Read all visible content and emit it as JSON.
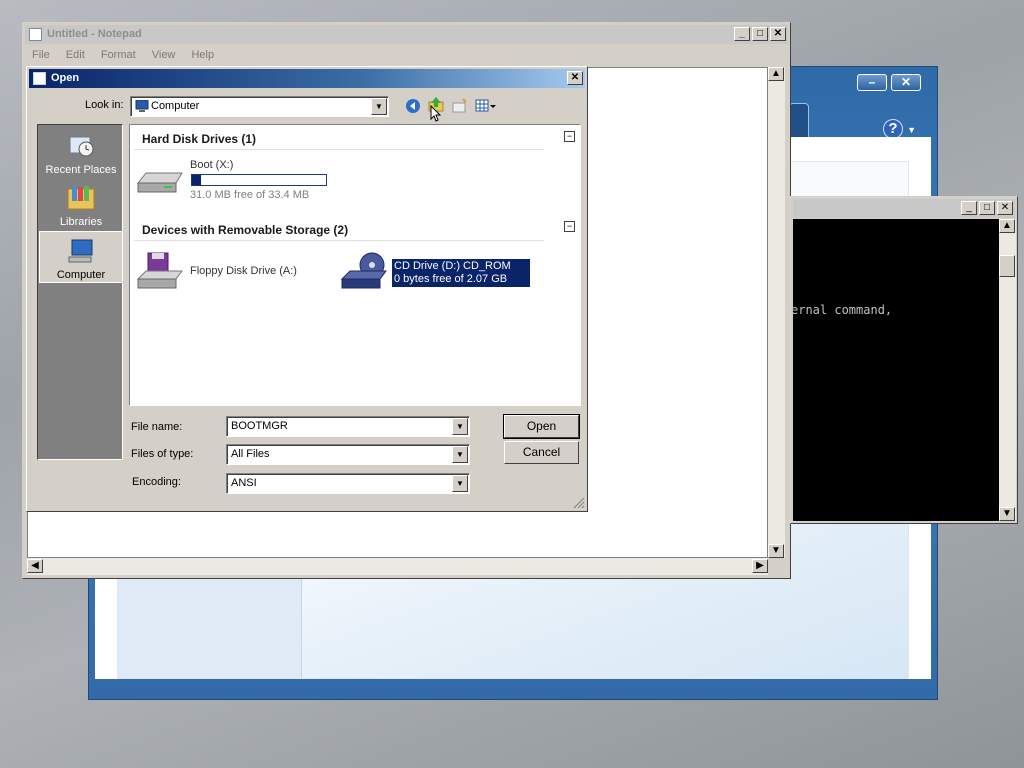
{
  "notepad": {
    "title": "Untitled - Notepad",
    "menu": [
      "File",
      "Edit",
      "Format",
      "View",
      "Help"
    ]
  },
  "setup_window": {
    "help_glyph": "?",
    "minimize": "–",
    "close": "✕"
  },
  "cmd": {
    "visible_text": "ernal command,"
  },
  "open_dialog": {
    "title": "Open",
    "look_in_label": "Look in:",
    "look_in_value": "Computer",
    "places": [
      {
        "label": "Recent Places",
        "icon": "recent-places-icon"
      },
      {
        "label": "Libraries",
        "icon": "libraries-icon"
      },
      {
        "label": "Computer",
        "icon": "computer-icon",
        "selected": true
      }
    ],
    "groups": [
      {
        "heading": "Hard Disk Drives (1)"
      },
      {
        "heading": "Devices with Removable Storage (2)"
      }
    ],
    "drives": {
      "boot": {
        "name": "Boot (X:)",
        "free_text": "31.0 MB free of 33.4 MB",
        "used_fraction": 0.07
      },
      "floppy": {
        "name": "Floppy Disk Drive (A:)"
      },
      "cd": {
        "name": "CD Drive (D:) CD_ROM",
        "free_text": "0 bytes free of 2.07 GB"
      }
    },
    "file_name_label": "File name:",
    "file_name_value": "BOOTMGR",
    "files_of_type_label": "Files of type:",
    "files_of_type_value": "All Files",
    "encoding_label": "Encoding:",
    "encoding_value": "ANSI",
    "open_button": "Open",
    "cancel_button": "Cancel"
  },
  "colors": {
    "selection": "#0a246a",
    "title_active": "#0a246a",
    "setup_blue": "#3a6ea8"
  }
}
